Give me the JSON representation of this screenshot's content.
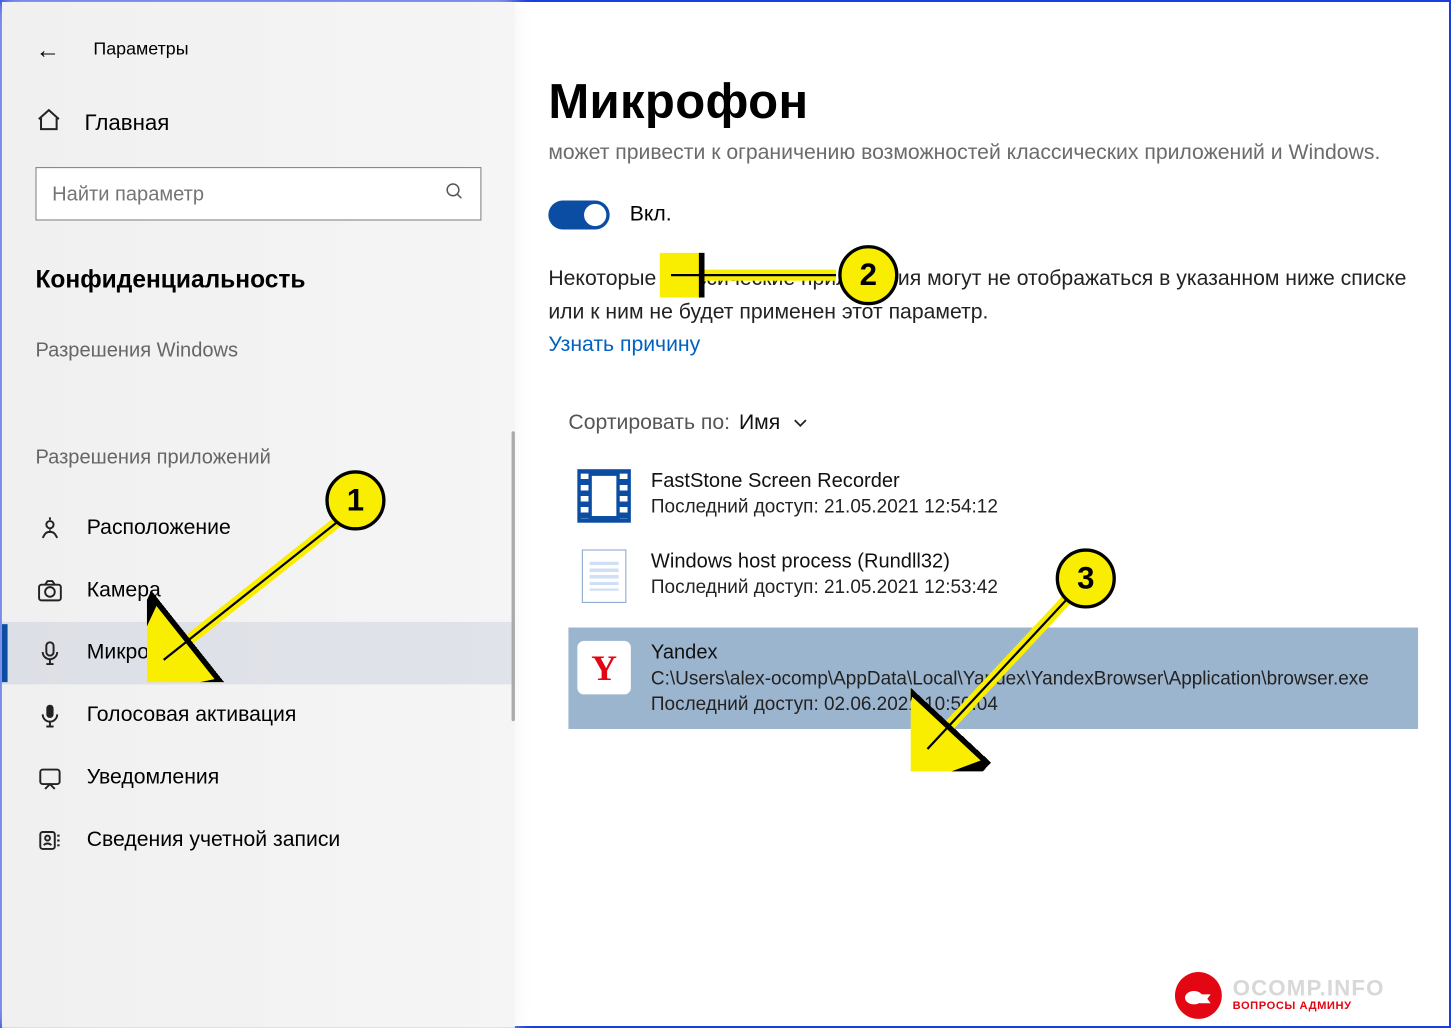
{
  "header": {
    "window_title": "Параметры",
    "home_label": "Главная"
  },
  "search": {
    "placeholder": "Найти параметр"
  },
  "sidebar": {
    "category": "Конфиденциальность",
    "group_windows": "Разрешения Windows",
    "group_apps": "Разрешения приложений",
    "items": {
      "location": "Расположение",
      "camera": "Камера",
      "microphone": "Микрофон",
      "voice": "Голосовая активация",
      "notifications": "Уведомления",
      "account": "Сведения учетной записи"
    }
  },
  "main": {
    "title": "Микрофон",
    "cutoff": "может привести к ограничению возможностей классических приложений и Windows.",
    "toggle_label": "Вкл.",
    "desc": "Некоторые классические приложения могут не отображаться в указанном ниже списке или к ним не будет применен этот параметр.",
    "link": "Узнать причину",
    "sort_label": "Сортировать по:",
    "sort_value": "Имя",
    "apps": [
      {
        "name": "FastStone Screen Recorder",
        "meta": "Последний доступ: 21.05.2021 12:54:12"
      },
      {
        "name": "Windows host process (Rundll32)",
        "meta": "Последний доступ: 21.05.2021 12:53:42"
      },
      {
        "name": "Yandex",
        "path": "C:\\Users\\alex-ocomp\\AppData\\Local\\Yandex\\YandexBrowser\\Application\\browser.exe",
        "meta": "Последний доступ: 02.06.2021 10:50:04"
      }
    ]
  },
  "annotations": {
    "b1": "1",
    "b2": "2",
    "b3": "3"
  },
  "watermark": {
    "main": "OCOMP.INFO",
    "sub": "ВОПРОСЫ АДМИНУ"
  }
}
